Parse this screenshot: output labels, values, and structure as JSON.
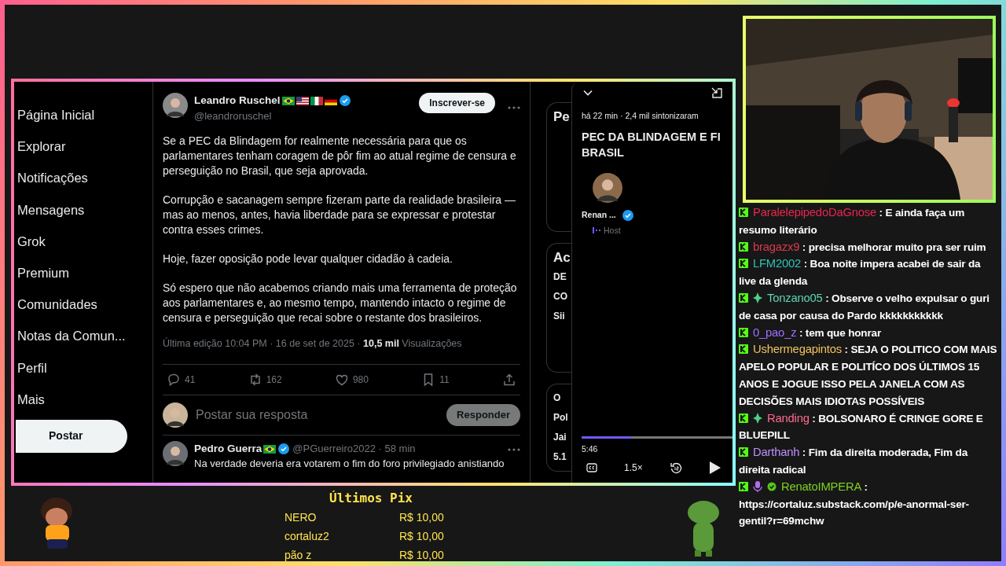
{
  "sidebar": {
    "items": [
      {
        "label": "Página Inicial"
      },
      {
        "label": "Explorar"
      },
      {
        "label": "Notificações"
      },
      {
        "label": "Mensagens"
      },
      {
        "label": "Grok"
      },
      {
        "label": "Premium"
      },
      {
        "label": "Comunidades"
      },
      {
        "label": "Notas da Comun..."
      },
      {
        "label": "Perfil"
      },
      {
        "label": "Mais"
      }
    ],
    "post_button": "Postar"
  },
  "tweet": {
    "author": "Leandro Ruschel",
    "handle": "@leandroruschel",
    "flags": [
      {
        "kind": "br"
      },
      {
        "kind": "us"
      },
      {
        "kind": "it"
      },
      {
        "kind": "de"
      }
    ],
    "verified": true,
    "follow_button": "Inscrever-se",
    "paragraphs": [
      "Se a PEC da Blindagem for realmente necessária para que os parlamentares tenham coragem de pôr fim ao atual regime de censura e perseguição no Brasil, que seja aprovada.",
      "Corrupção e sacanagem sempre fizeram parte da realidade brasileira — mas ao menos, antes, havia liberdade para se expressar e protestar contra esses crimes.",
      "Hoje, fazer oposição pode levar qualquer cidadão à cadeia.",
      "Só espero que não acabemos criando mais uma ferramenta de proteção aos parlamentares e, ao mesmo tempo, mantendo intacto o regime de censura e perseguição que recai sobre o restante dos brasileiros."
    ],
    "meta": "Última edição 10:04 PM · 16 de set de 2025 · **10,5 mil** Visualizações",
    "actions": [
      {
        "kind": "reply",
        "count": "41"
      },
      {
        "kind": "repost",
        "count": "162"
      },
      {
        "kind": "like",
        "count": "980"
      },
      {
        "kind": "bookmark",
        "count": "11"
      },
      {
        "kind": "share"
      }
    ]
  },
  "reply_box": {
    "placeholder": "Postar sua resposta",
    "button": "Responder",
    "disabled": true
  },
  "reply": {
    "author": "Pedro Guerra",
    "flags": [
      {
        "kind": "br"
      }
    ],
    "verified": true,
    "handle": "@PGuerreiro2022 · 58 min",
    "text": "Na verdade deveria era votarem o fim do foro privilegiado anistiando"
  },
  "side_fragments": [
    {
      "lines": [
        "Pe"
      ]
    },
    {
      "lines": [
        "Ac",
        "DE",
        "CO",
        "Sii"
      ]
    },
    {
      "lines": [
        "O",
        "Pol",
        "Jai",
        "5.1"
      ]
    }
  ],
  "space": {
    "meta": "há 22 min · 2,4 mil sintonizaram",
    "title_lines": [
      "PEC DA BLINDAGEM E FI",
      "BRASIL"
    ],
    "host_name": "Renan ...",
    "host_verified": true,
    "host_label": "Host",
    "level": 0.33,
    "time": "5:46",
    "speed": "1.5×"
  },
  "chat": [
    {
      "badges": [
        {
          "kind": "k"
        }
      ],
      "user": "ParalelepipedoDaGnose",
      "color": "#e8264f",
      "text": ": E ainda faça um resumo literário"
    },
    {
      "badges": [
        {
          "kind": "k"
        }
      ],
      "user": "bragazx9",
      "color": "#d93a4c",
      "text": ": precisa melhorar muito pra ser ruim"
    },
    {
      "badges": [
        {
          "kind": "k"
        }
      ],
      "user": "LFM2002",
      "color": "#2ec4b6",
      "text": ": Boa noite impera acabei de sair da live da glenda"
    },
    {
      "badges": [
        {
          "kind": "k"
        },
        {
          "kind": "diamond"
        }
      ],
      "user": "Tonzano05",
      "color": "#5ed6b4",
      "text": ": Observe o velho expulsar o guri de casa por causa do Pardo kkkkkkkkkkk"
    },
    {
      "badges": [
        {
          "kind": "k"
        }
      ],
      "user": "0_pao_z",
      "color": "#a070ff",
      "text": ": tem que honrar"
    },
    {
      "badges": [
        {
          "kind": "k"
        }
      ],
      "user": "Ushermegapintos",
      "color": "#f2c35e",
      "text": ": SEJA O POLITICO COM MAIS APELO POPULAR E POLITÍCO DOS ÚLTIMOS 15 ANOS E JOGUE ISSO PELA JANELA COM AS DECISÕES MAIS IDIOTAS POSSÍVEIS"
    },
    {
      "badges": [
        {
          "kind": "k"
        },
        {
          "kind": "diamond"
        }
      ],
      "user": "Randing",
      "color": "#ff6b8e",
      "text": ": BOLSONARO É CRINGE GORE E BLUEPILL"
    },
    {
      "badges": [
        {
          "kind": "k"
        }
      ],
      "user": "Darthanh",
      "color": "#c090ff",
      "text": ": Fim da direita moderada, Fim da direita radical"
    },
    {
      "badges": [
        {
          "kind": "k"
        },
        {
          "kind": "mic"
        },
        {
          "kind": "check"
        }
      ],
      "user": "RenatoIMPERA",
      "color": "#7ed321",
      "text": ": https://cortaluz.substack.com/p/e-anormal-ser-gentil?r=69mchw"
    }
  ],
  "donations": {
    "title": "Últimos Pix",
    "rows": [
      {
        "name": "NERO",
        "amount": "R$ 10,00"
      },
      {
        "name": "cortaluz2",
        "amount": "R$ 10,00"
      },
      {
        "name": "pão z",
        "amount": "R$ 10,00"
      }
    ]
  }
}
